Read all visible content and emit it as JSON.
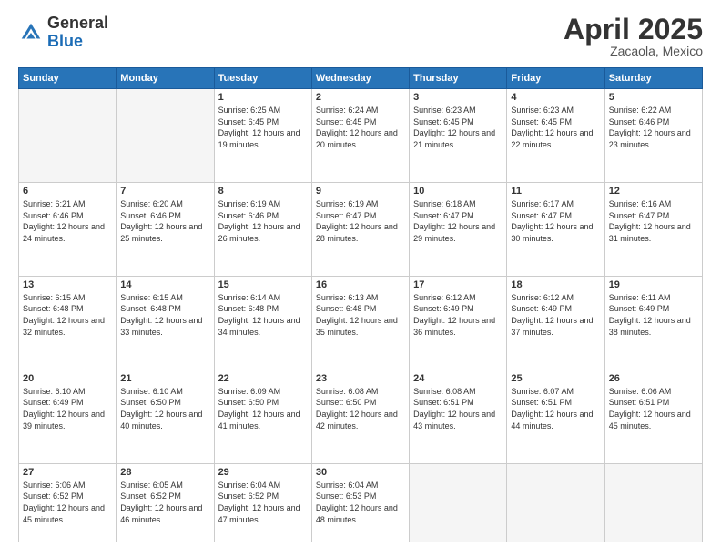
{
  "header": {
    "logo_general": "General",
    "logo_blue": "Blue",
    "title": "April 2025",
    "location": "Zacaola, Mexico"
  },
  "days_of_week": [
    "Sunday",
    "Monday",
    "Tuesday",
    "Wednesday",
    "Thursday",
    "Friday",
    "Saturday"
  ],
  "weeks": [
    [
      {
        "day": "",
        "info": ""
      },
      {
        "day": "",
        "info": ""
      },
      {
        "day": "1",
        "info": "Sunrise: 6:25 AM\nSunset: 6:45 PM\nDaylight: 12 hours and 19 minutes."
      },
      {
        "day": "2",
        "info": "Sunrise: 6:24 AM\nSunset: 6:45 PM\nDaylight: 12 hours and 20 minutes."
      },
      {
        "day": "3",
        "info": "Sunrise: 6:23 AM\nSunset: 6:45 PM\nDaylight: 12 hours and 21 minutes."
      },
      {
        "day": "4",
        "info": "Sunrise: 6:23 AM\nSunset: 6:45 PM\nDaylight: 12 hours and 22 minutes."
      },
      {
        "day": "5",
        "info": "Sunrise: 6:22 AM\nSunset: 6:46 PM\nDaylight: 12 hours and 23 minutes."
      }
    ],
    [
      {
        "day": "6",
        "info": "Sunrise: 6:21 AM\nSunset: 6:46 PM\nDaylight: 12 hours and 24 minutes."
      },
      {
        "day": "7",
        "info": "Sunrise: 6:20 AM\nSunset: 6:46 PM\nDaylight: 12 hours and 25 minutes."
      },
      {
        "day": "8",
        "info": "Sunrise: 6:19 AM\nSunset: 6:46 PM\nDaylight: 12 hours and 26 minutes."
      },
      {
        "day": "9",
        "info": "Sunrise: 6:19 AM\nSunset: 6:47 PM\nDaylight: 12 hours and 28 minutes."
      },
      {
        "day": "10",
        "info": "Sunrise: 6:18 AM\nSunset: 6:47 PM\nDaylight: 12 hours and 29 minutes."
      },
      {
        "day": "11",
        "info": "Sunrise: 6:17 AM\nSunset: 6:47 PM\nDaylight: 12 hours and 30 minutes."
      },
      {
        "day": "12",
        "info": "Sunrise: 6:16 AM\nSunset: 6:47 PM\nDaylight: 12 hours and 31 minutes."
      }
    ],
    [
      {
        "day": "13",
        "info": "Sunrise: 6:15 AM\nSunset: 6:48 PM\nDaylight: 12 hours and 32 minutes."
      },
      {
        "day": "14",
        "info": "Sunrise: 6:15 AM\nSunset: 6:48 PM\nDaylight: 12 hours and 33 minutes."
      },
      {
        "day": "15",
        "info": "Sunrise: 6:14 AM\nSunset: 6:48 PM\nDaylight: 12 hours and 34 minutes."
      },
      {
        "day": "16",
        "info": "Sunrise: 6:13 AM\nSunset: 6:48 PM\nDaylight: 12 hours and 35 minutes."
      },
      {
        "day": "17",
        "info": "Sunrise: 6:12 AM\nSunset: 6:49 PM\nDaylight: 12 hours and 36 minutes."
      },
      {
        "day": "18",
        "info": "Sunrise: 6:12 AM\nSunset: 6:49 PM\nDaylight: 12 hours and 37 minutes."
      },
      {
        "day": "19",
        "info": "Sunrise: 6:11 AM\nSunset: 6:49 PM\nDaylight: 12 hours and 38 minutes."
      }
    ],
    [
      {
        "day": "20",
        "info": "Sunrise: 6:10 AM\nSunset: 6:49 PM\nDaylight: 12 hours and 39 minutes."
      },
      {
        "day": "21",
        "info": "Sunrise: 6:10 AM\nSunset: 6:50 PM\nDaylight: 12 hours and 40 minutes."
      },
      {
        "day": "22",
        "info": "Sunrise: 6:09 AM\nSunset: 6:50 PM\nDaylight: 12 hours and 41 minutes."
      },
      {
        "day": "23",
        "info": "Sunrise: 6:08 AM\nSunset: 6:50 PM\nDaylight: 12 hours and 42 minutes."
      },
      {
        "day": "24",
        "info": "Sunrise: 6:08 AM\nSunset: 6:51 PM\nDaylight: 12 hours and 43 minutes."
      },
      {
        "day": "25",
        "info": "Sunrise: 6:07 AM\nSunset: 6:51 PM\nDaylight: 12 hours and 44 minutes."
      },
      {
        "day": "26",
        "info": "Sunrise: 6:06 AM\nSunset: 6:51 PM\nDaylight: 12 hours and 45 minutes."
      }
    ],
    [
      {
        "day": "27",
        "info": "Sunrise: 6:06 AM\nSunset: 6:52 PM\nDaylight: 12 hours and 45 minutes."
      },
      {
        "day": "28",
        "info": "Sunrise: 6:05 AM\nSunset: 6:52 PM\nDaylight: 12 hours and 46 minutes."
      },
      {
        "day": "29",
        "info": "Sunrise: 6:04 AM\nSunset: 6:52 PM\nDaylight: 12 hours and 47 minutes."
      },
      {
        "day": "30",
        "info": "Sunrise: 6:04 AM\nSunset: 6:53 PM\nDaylight: 12 hours and 48 minutes."
      },
      {
        "day": "",
        "info": ""
      },
      {
        "day": "",
        "info": ""
      },
      {
        "day": "",
        "info": ""
      }
    ]
  ]
}
